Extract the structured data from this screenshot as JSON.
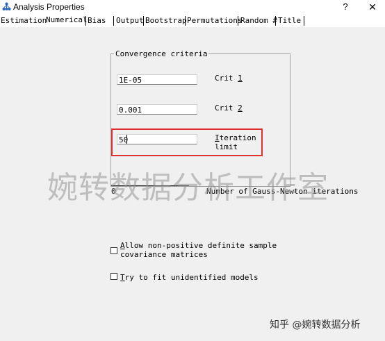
{
  "window": {
    "title": "Analysis Properties",
    "help_label": "?",
    "close_label": "✕"
  },
  "tabs": [
    {
      "label": "Estimation",
      "active": false
    },
    {
      "label": "Numerical",
      "active": true
    },
    {
      "label": "Bias",
      "active": false
    },
    {
      "label": "Output",
      "active": false
    },
    {
      "label": "Bootstrap",
      "active": false
    },
    {
      "label": "Permutations",
      "active": false
    },
    {
      "label": "Random #",
      "active": false
    },
    {
      "label": "Title",
      "active": false
    }
  ],
  "convergence": {
    "title": "Convergence criteria",
    "crit1": {
      "value": "1E-05",
      "label_pre": "Crit ",
      "label_key": "1"
    },
    "crit2": {
      "value": "0.001",
      "label_pre": "Crit ",
      "label_key": "2"
    },
    "iteration": {
      "value": "50",
      "label_key": "I",
      "label_rest": "teration",
      "label_line2": "limit"
    }
  },
  "gauss": {
    "value": "0",
    "label": "Number of Gauss-Newton iterations"
  },
  "options": {
    "nonpositive": {
      "key": "A",
      "rest": "llow non-positive definite sample",
      "line2": "covariance matrices",
      "checked": false
    },
    "unidentified": {
      "key": "T",
      "rest": "ry to fit unidentified models",
      "checked": false
    }
  },
  "watermarks": {
    "center": "婉转数据分析工作室",
    "footer": "知乎 @婉转数据分析"
  },
  "colors": {
    "highlight_border": "#e03030",
    "panel_bg": "#f0f0f0"
  }
}
